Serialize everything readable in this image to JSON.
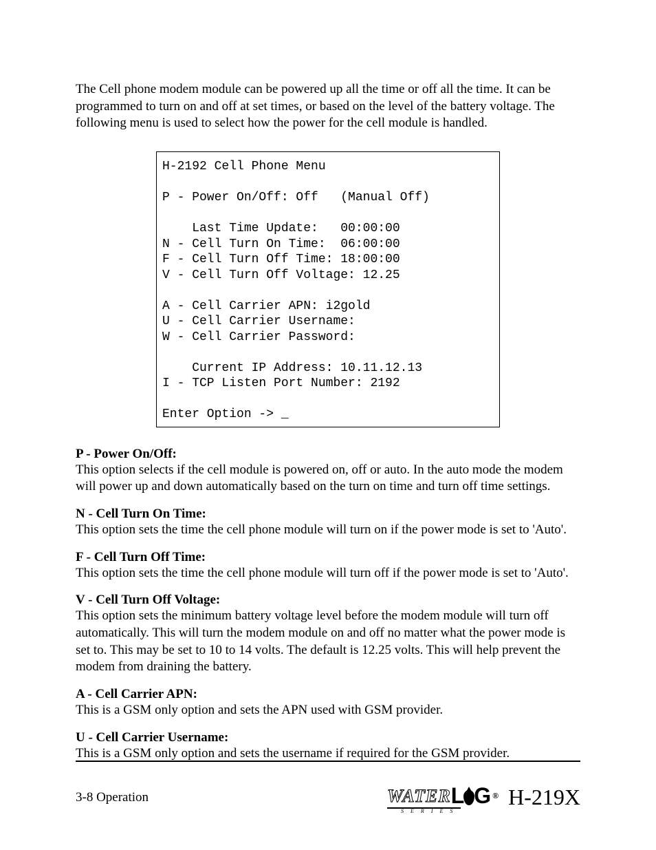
{
  "intro": "The Cell phone modem module can be powered up all the time or off all the time.  It can be programmed to turn on and off at set times, or based on the level of the battery voltage.  The following menu is used to select how the power for the cell module is handled.",
  "menu": {
    "title": "H-2192 Cell Phone Menu",
    "p": "P - Power On/Off: Off   (Manual Off)",
    "last": "    Last Time Update:   00:00:00",
    "n": "N - Cell Turn On Time:  06:00:00",
    "f": "F - Cell Turn Off Time: 18:00:00",
    "v": "V - Cell Turn Off Voltage: 12.25",
    "a": "A - Cell Carrier APN: i2gold",
    "u": "U - Cell Carrier Username:",
    "w": "W - Cell Carrier Password:",
    "ip": "    Current IP Address: 10.11.12.13",
    "i": "I - TCP Listen Port Number: 2192",
    "prompt": "Enter Option -> _"
  },
  "sections": {
    "p": {
      "h": "P - Power On/Off:",
      "b": "This option selects if the cell module is powered on, off or auto.  In the auto mode the modem will power up and down automatically based on the turn on time and turn off time settings."
    },
    "n": {
      "h": "N - Cell Turn On Time:",
      "b": "This option sets the time the cell phone module will turn on if the power mode is set to 'Auto'."
    },
    "f": {
      "h": "F - Cell Turn Off Time:",
      "b": "This option sets the time the cell phone module will turn off if the power mode is set to 'Auto'."
    },
    "v": {
      "h": "V - Cell Turn Off Voltage:",
      "b": "This option sets the minimum battery voltage level before the modem module will turn off automatically.  This will turn the modem module on and off no matter what the power mode is set to.  This may be set to 10 to 14 volts.  The default is 12.25 volts.  This will help prevent the modem from draining the battery."
    },
    "a": {
      "h": "A - Cell Carrier APN:",
      "b": "This is a GSM only option and sets the APN used with GSM provider."
    },
    "u": {
      "h": "U - Cell Carrier Username:",
      "b": "This is a GSM only option and sets the username if required for the GSM provider."
    }
  },
  "footer": {
    "left": "3-8  Operation",
    "logo_water": "WATER",
    "logo_l": "L",
    "logo_g": "G",
    "logo_reg": "®",
    "logo_series": "S E R I E S",
    "model": "H-219X"
  }
}
